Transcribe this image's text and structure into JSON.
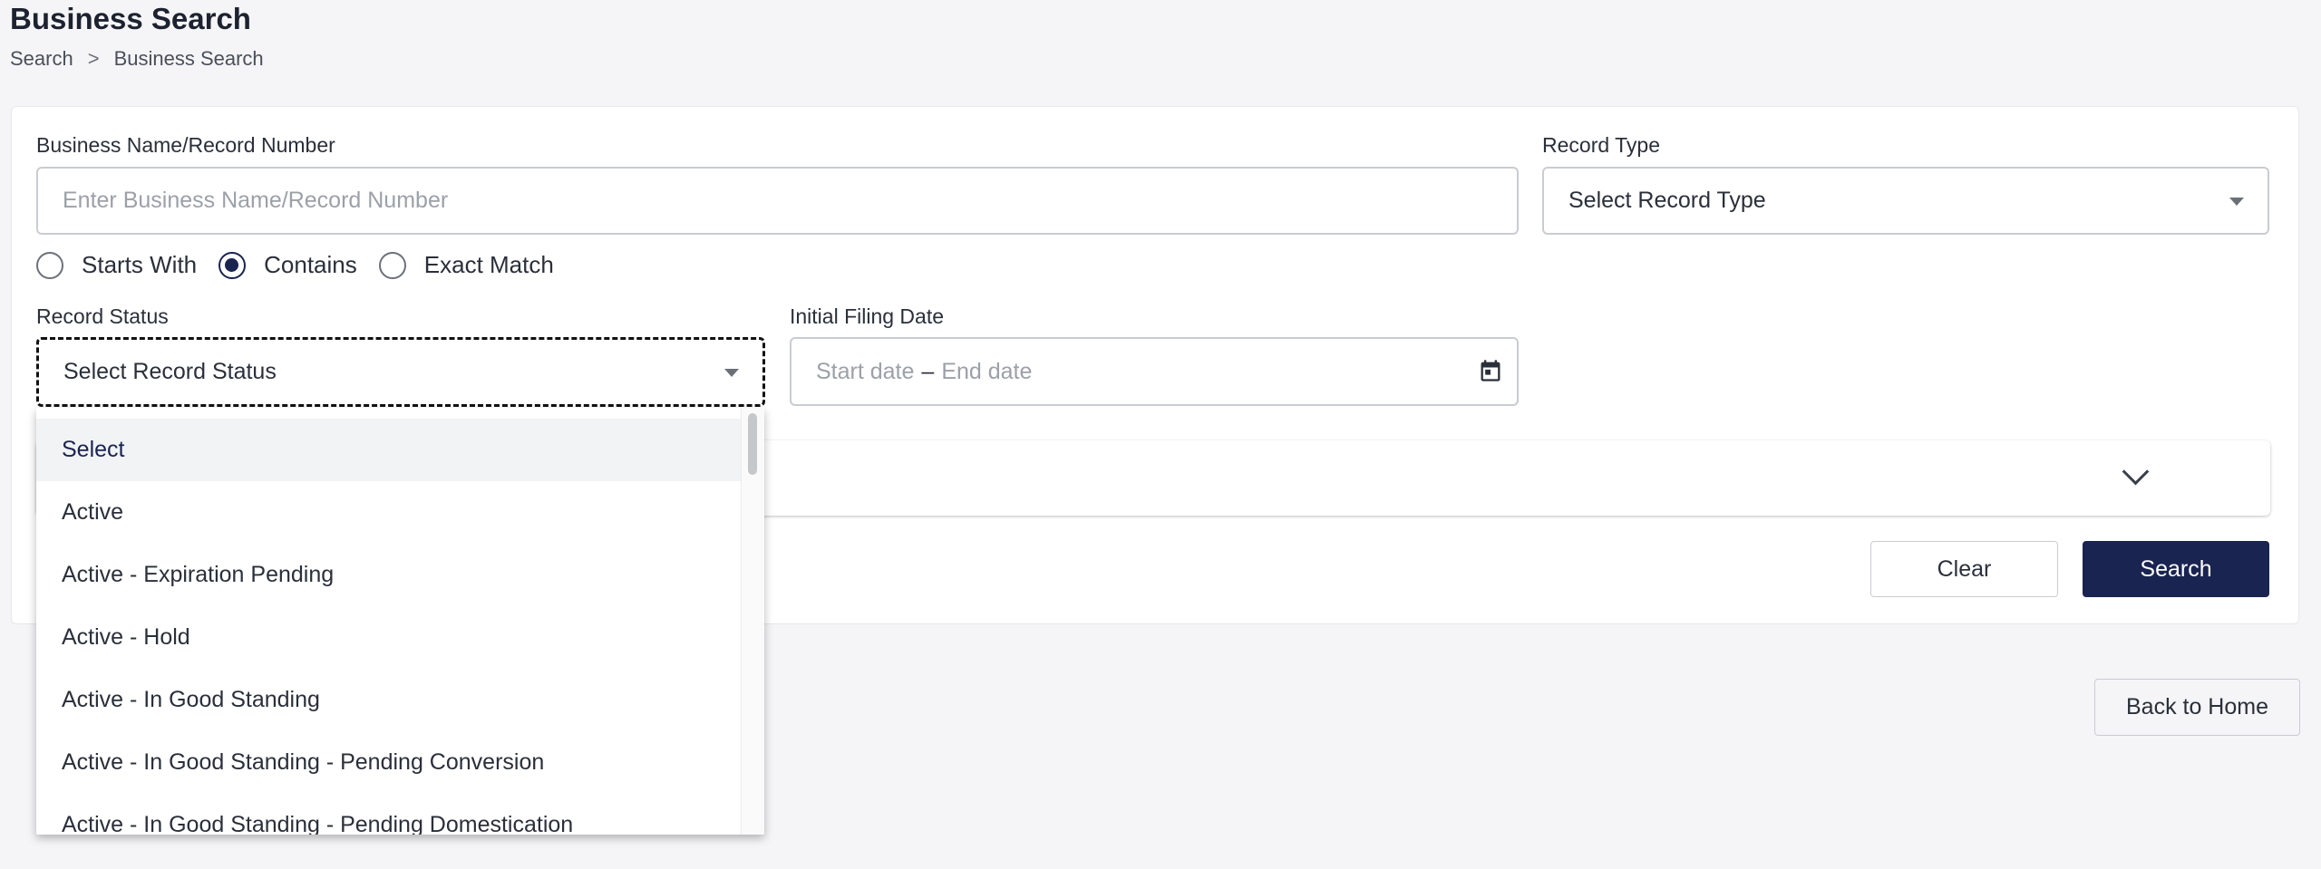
{
  "header": {
    "title": "Business Search",
    "breadcrumb": [
      "Search",
      "Business Search"
    ],
    "breadcrumb_sep": ">"
  },
  "form": {
    "business_name_label": "Business Name/Record Number",
    "business_name_placeholder": "Enter Business Name/Record Number",
    "business_name_value": "",
    "record_type_label": "Record Type",
    "record_type_value": "Select Record Type",
    "match_options": [
      {
        "label": "Starts With",
        "checked": false
      },
      {
        "label": "Contains",
        "checked": true
      },
      {
        "label": "Exact Match",
        "checked": false
      }
    ],
    "record_status_label": "Record Status",
    "record_status_value": "Select Record Status",
    "filing_date_label": "Initial Filing Date",
    "start_date_placeholder": "Start date",
    "date_separator": "–",
    "end_date_placeholder": "End date"
  },
  "buttons": {
    "clear": "Clear",
    "search": "Search",
    "back_home": "Back to Home"
  },
  "record_status_options": [
    "Select",
    "Active",
    "Active - Expiration Pending",
    "Active - Hold",
    "Active - In Good Standing",
    "Active - In Good Standing - Pending Conversion",
    "Active - In Good Standing - Pending Domestication"
  ],
  "colors": {
    "primary": "#1a2450",
    "background": "#f5f5f7"
  }
}
